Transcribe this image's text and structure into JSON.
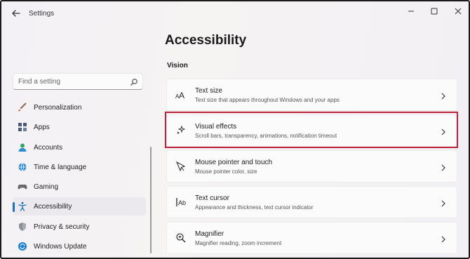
{
  "window": {
    "app_title": "Settings",
    "controls": [
      "minimize-icon",
      "maximize-icon",
      "close-icon"
    ]
  },
  "sidebar": {
    "search_placeholder": "Find a setting",
    "items": [
      {
        "label": "Personalization",
        "icon": "brush-icon",
        "active": false
      },
      {
        "label": "Apps",
        "icon": "apps-icon",
        "active": false
      },
      {
        "label": "Accounts",
        "icon": "person-icon",
        "active": false
      },
      {
        "label": "Time & language",
        "icon": "globe-clock-icon",
        "active": false
      },
      {
        "label": "Gaming",
        "icon": "gamepad-icon",
        "active": false
      },
      {
        "label": "Accessibility",
        "icon": "accessibility-icon",
        "active": true
      },
      {
        "label": "Privacy & security",
        "icon": "shield-icon",
        "active": false
      },
      {
        "label": "Windows Update",
        "icon": "update-icon",
        "active": false
      }
    ]
  },
  "main": {
    "page_title": "Accessibility",
    "section_title": "Vision",
    "cards": [
      {
        "title": "Text size",
        "subtitle": "Text size that appears throughout Windows and your apps",
        "icon": "text-size-icon",
        "highlighted": false
      },
      {
        "title": "Visual effects",
        "subtitle": "Scroll bars, transparency, animations, notification timeout",
        "icon": "sparkle-icon",
        "highlighted": true
      },
      {
        "title": "Mouse pointer and touch",
        "subtitle": "Mouse pointer color, size",
        "icon": "mouse-pointer-icon",
        "highlighted": false
      },
      {
        "title": "Text cursor",
        "subtitle": "Appearance and thickness, text cursor indicator",
        "icon": "text-cursor-icon",
        "highlighted": false
      },
      {
        "title": "Magnifier",
        "subtitle": "Magnifier reading, zoom increment",
        "icon": "magnifier-icon",
        "highlighted": false
      }
    ]
  },
  "colors": {
    "accent": "#1f6fbf",
    "highlight_border": "#c0213a"
  }
}
